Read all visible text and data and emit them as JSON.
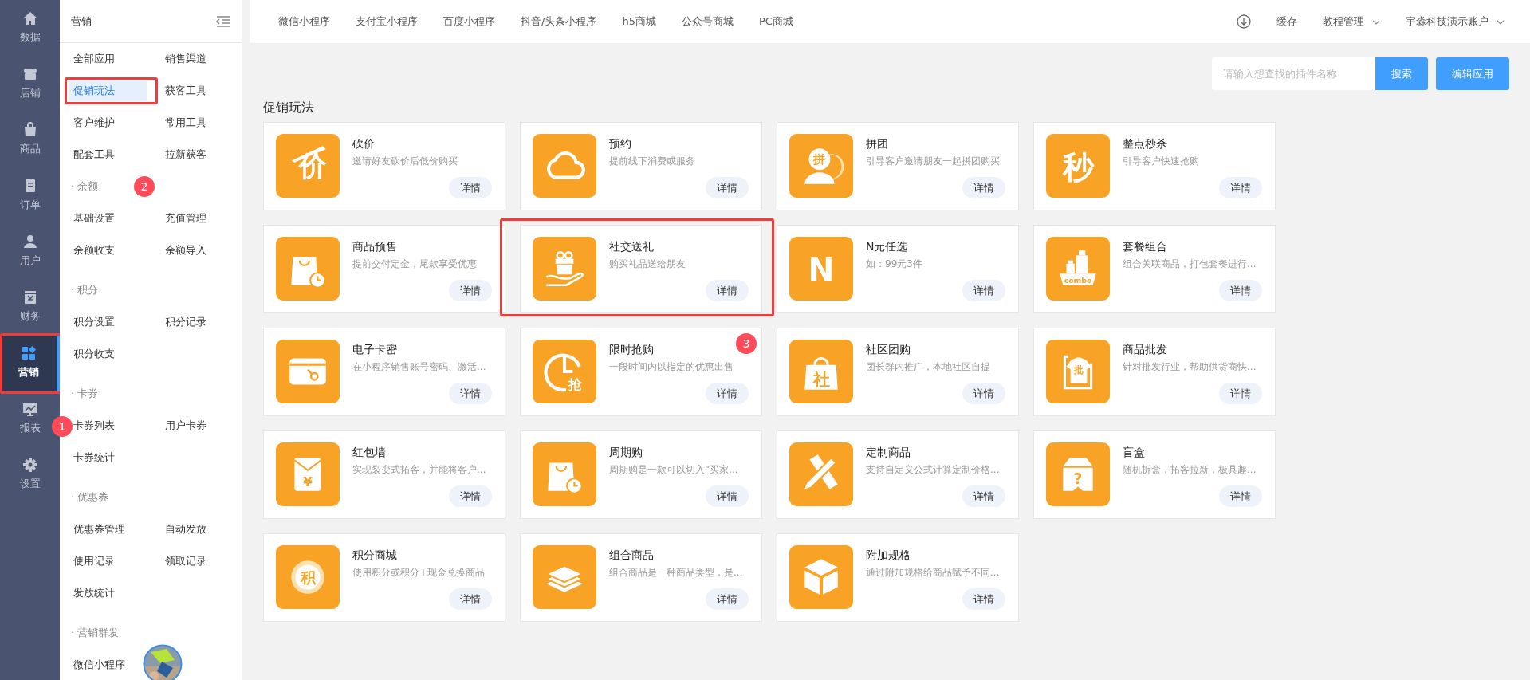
{
  "rail": [
    {
      "label": "数据",
      "kind": "home",
      "selected": false
    },
    {
      "label": "店铺",
      "kind": "shop",
      "selected": false
    },
    {
      "label": "商品",
      "kind": "bag",
      "selected": false
    },
    {
      "label": "订单",
      "kind": "doc",
      "selected": false
    },
    {
      "label": "用户",
      "kind": "user",
      "selected": false
    },
    {
      "label": "财务",
      "kind": "money",
      "selected": false
    },
    {
      "label": "营销",
      "kind": "grid",
      "selected": true,
      "highlighted": true
    },
    {
      "label": "报表",
      "kind": "chart",
      "selected": false
    },
    {
      "label": "设置",
      "kind": "gear",
      "selected": false
    }
  ],
  "submenu": {
    "title": "营销",
    "groups": [
      {
        "items": [
          {
            "label": "全部应用",
            "selected": false
          },
          {
            "label": "销售渠道",
            "selected": false
          },
          {
            "label": "促销玩法",
            "selected": true,
            "highlighted": true
          },
          {
            "label": "获客工具",
            "selected": false
          },
          {
            "label": "客户维护",
            "selected": false
          },
          {
            "label": "常用工具",
            "selected": false
          },
          {
            "label": "配套工具",
            "selected": false
          },
          {
            "label": "拉新获客",
            "selected": false
          }
        ]
      },
      {
        "header": "· 余额",
        "marker": "2",
        "items": [
          {
            "label": "基础设置",
            "selected": false
          },
          {
            "label": "充值管理",
            "selected": false
          },
          {
            "label": "余额收支",
            "selected": false
          },
          {
            "label": "余额导入",
            "selected": false
          }
        ]
      },
      {
        "header": "· 积分",
        "items": [
          {
            "label": "积分设置",
            "selected": false
          },
          {
            "label": "积分记录",
            "selected": false
          },
          {
            "label": "积分收支",
            "selected": false
          }
        ]
      },
      {
        "header": "· 卡券",
        "items": [
          {
            "label": "卡券列表",
            "selected": false,
            "marker": "1"
          },
          {
            "label": "用户卡券",
            "selected": false
          },
          {
            "label": "卡券统计",
            "selected": false
          }
        ]
      },
      {
        "header": "· 优惠券",
        "items": [
          {
            "label": "优惠券管理",
            "selected": false
          },
          {
            "label": "自动发放",
            "selected": false
          },
          {
            "label": "使用记录",
            "selected": false
          },
          {
            "label": "领取记录",
            "selected": false
          },
          {
            "label": "发放统计",
            "selected": false
          }
        ]
      },
      {
        "header": "· 营销群发",
        "items": [
          {
            "label": "微信小程序",
            "selected": false
          }
        ]
      }
    ]
  },
  "topnav": {
    "links": [
      "微信小程序",
      "支付宝小程序",
      "百度小程序",
      "抖音/头条小程序",
      "h5商城",
      "公众号商城",
      "PC商城"
    ],
    "cache": "缓存",
    "tutorial": "教程管理",
    "account": "宇淼科技演示账户"
  },
  "search": {
    "placeholder": "请输入想查找的插件名称",
    "button": "搜索"
  },
  "edit_button": "编辑应用",
  "section_title": "促销玩法",
  "apps": [
    {
      "title": "砍价",
      "desc": "邀请好友砍价后低价购买",
      "kind": "knife",
      "icon_text": "价",
      "button": "详情"
    },
    {
      "title": "预约",
      "desc": "提前线下消费或服务",
      "kind": "cloud",
      "button": "详情"
    },
    {
      "title": "拼团",
      "desc": "引导客户邀请朋友一起拼团购买",
      "kind": "person",
      "icon_text": "拼",
      "button": "详情"
    },
    {
      "title": "整点秒杀",
      "desc": "引导客户快速抢购",
      "kind": "plain",
      "icon_text": "秒",
      "button": "详情"
    },
    {
      "title": "商品预售",
      "desc": "提前交付定金，尾款享受优惠",
      "kind": "bag-clock",
      "button": "详情"
    },
    {
      "title": "社交送礼",
      "desc": "购买礼品送给朋友",
      "kind": "gift",
      "button": "详情",
      "highlighted": true
    },
    {
      "title": "N元任选",
      "desc": "如：99元3件",
      "kind": "plain",
      "icon_text": "N",
      "button": "详情"
    },
    {
      "title": "套餐组合",
      "desc": "组合关联商品，打包套餐进行...",
      "kind": "bottles",
      "icon_text": "combo",
      "button": "详情"
    },
    {
      "title": "电子卡密",
      "desc": "在小程序销售账号密码、激活...",
      "kind": "card-key",
      "button": "详情"
    },
    {
      "title": "限时抢购",
      "desc": "一段时间内以指定的优惠出售",
      "kind": "clock",
      "icon_text": "抢",
      "button": "详情",
      "marker": "3"
    },
    {
      "title": "社区团购",
      "desc": "团长群内推广，本地社区自提",
      "kind": "bag",
      "icon_text": "社",
      "button": "详情"
    },
    {
      "title": "商品批发",
      "desc": "针对批发行业，帮助供货商快...",
      "kind": "shirt",
      "icon_text": "批",
      "button": "详情"
    },
    {
      "title": "红包墙",
      "desc": "实现裂变式拓客，并能将客户...",
      "kind": "envelope",
      "icon_text": "¥",
      "button": "详情"
    },
    {
      "title": "周期购",
      "desc": "周期购是一款可以切入“买家...",
      "kind": "bag-clock",
      "button": "详情"
    },
    {
      "title": "定制商品",
      "desc": "支持自定义公式计算定制价格...",
      "kind": "pencil",
      "button": "详情"
    },
    {
      "title": "盲盒",
      "desc": "随机拆盒，拓客拉新，极具趣...",
      "kind": "box",
      "icon_text": "?",
      "button": "详情"
    },
    {
      "title": "积分商城",
      "desc": "使用积分或积分+现金兑换商品",
      "kind": "coin",
      "icon_text": "积",
      "button": "详情"
    },
    {
      "title": "组合商品",
      "desc": "组合商品是一种商品类型，是...",
      "kind": "layers",
      "button": "详情"
    },
    {
      "title": "附加规格",
      "desc": "通过附加规格给商品赋予不同...",
      "kind": "cube",
      "button": "详情"
    }
  ]
}
